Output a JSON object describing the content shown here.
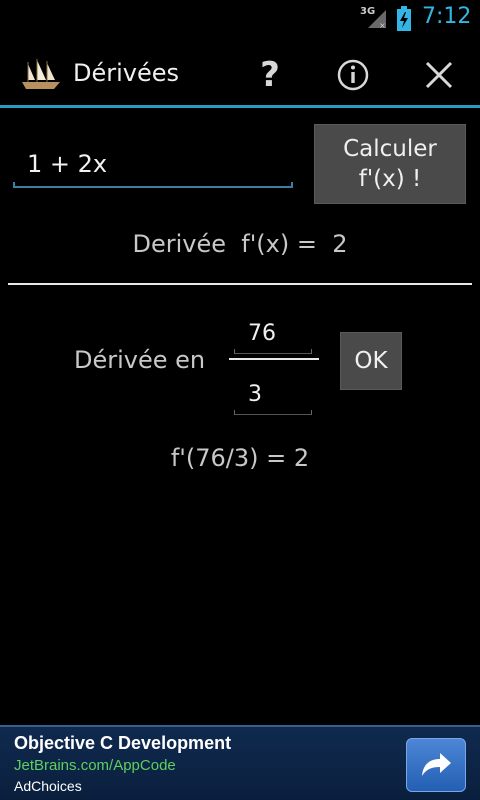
{
  "status_bar": {
    "network": "3G",
    "time": "7:12",
    "icons": [
      "signal-icon",
      "battery-charging-icon"
    ]
  },
  "action_bar": {
    "title": "Dérivées",
    "icons": [
      "app-ship-icon",
      "help-icon",
      "info-icon",
      "close-icon"
    ],
    "help_label": "?",
    "accent_color": "#33b5e5"
  },
  "function_panel": {
    "input_value": "1 + 2x",
    "calc_button_line1": "Calculer",
    "calc_button_line2": "f'(x) !",
    "result_text": "Derivée  f'(x) =  2"
  },
  "evaluate_panel": {
    "label": "Dérivée en",
    "numerator": "76",
    "denominator": "3",
    "ok_label": "OK",
    "result_text": "f'(76/3) = 2"
  },
  "ad": {
    "title": "Objective C Development",
    "url": "JetBrains.com/AppCode",
    "choices": "AdChoices",
    "icon": "share-arrow-icon",
    "url_color": "#5fcf5f"
  }
}
